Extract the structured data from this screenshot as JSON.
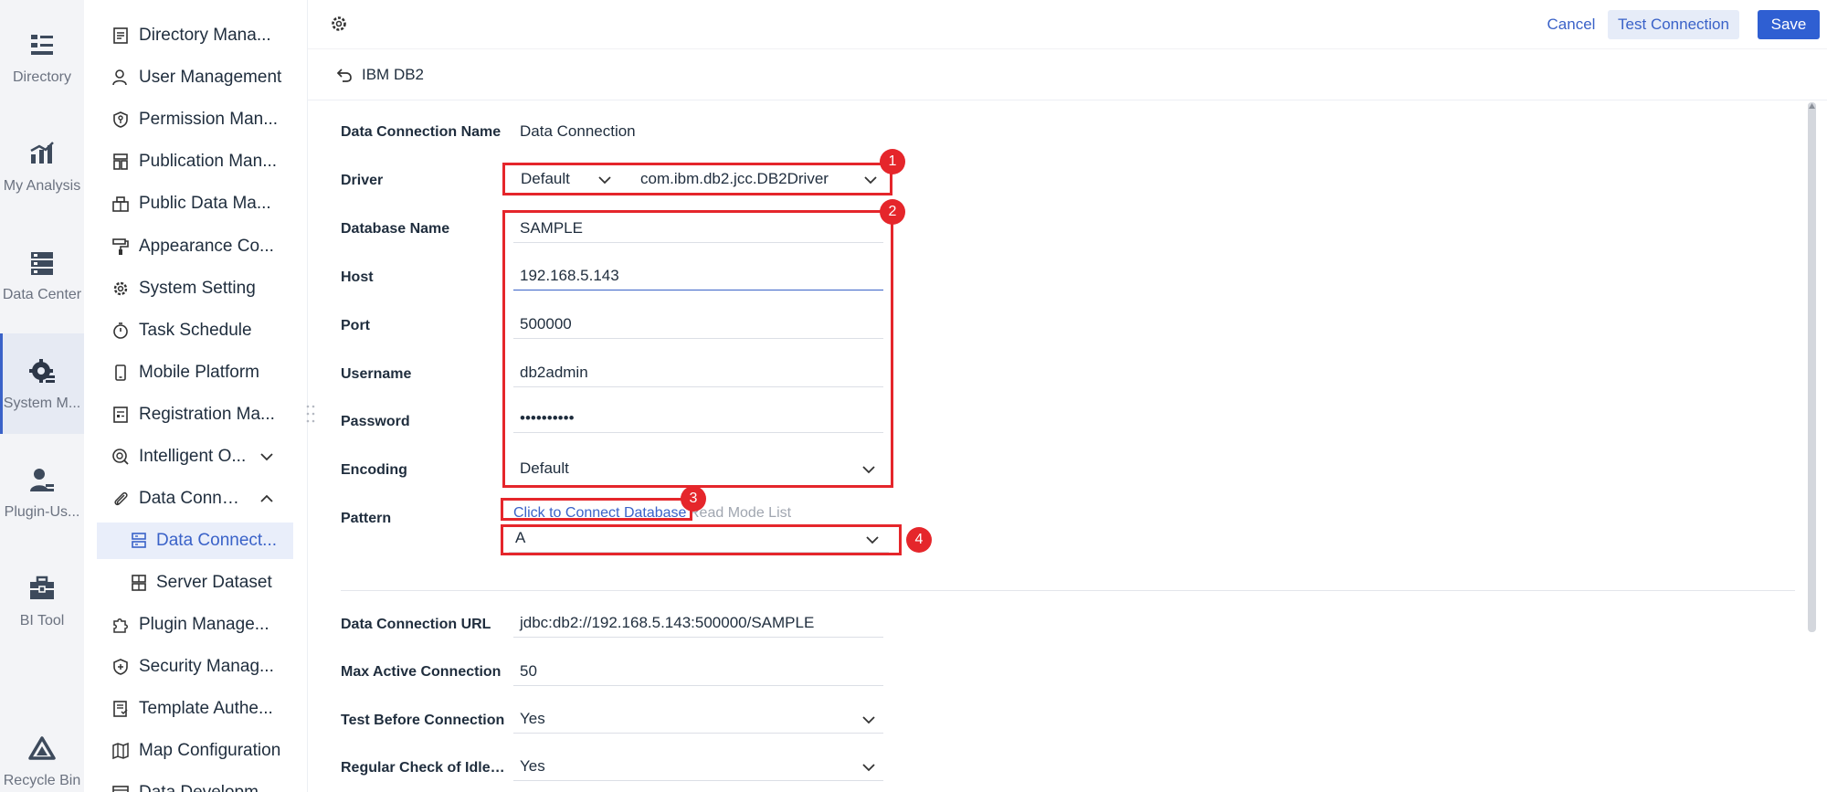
{
  "rail": {
    "items": [
      {
        "label": "Directory",
        "icon": "directory-icon"
      },
      {
        "label": "My Analysis",
        "icon": "analysis-icon"
      },
      {
        "label": "Data Center",
        "icon": "data-center-icon"
      },
      {
        "label": "System M...",
        "icon": "system-icon"
      },
      {
        "label": "Plugin-Us...",
        "icon": "plugin-user-icon"
      },
      {
        "label": "BI Tool",
        "icon": "toolbox-icon"
      },
      {
        "label": "Recycle Bin",
        "icon": "recycle-icon"
      }
    ]
  },
  "sidebar": {
    "items": [
      {
        "label": "Directory Mana...",
        "icon": "document-icon"
      },
      {
        "label": "User Management",
        "icon": "user-icon"
      },
      {
        "label": "Permission Man...",
        "icon": "shield-key-icon"
      },
      {
        "label": "Publication Man...",
        "icon": "publication-icon"
      },
      {
        "label": "Public Data Ma...",
        "icon": "cube-icon"
      },
      {
        "label": "Appearance Co...",
        "icon": "paint-roller-icon"
      },
      {
        "label": "System Setting",
        "icon": "gear-icon"
      },
      {
        "label": "Task Schedule",
        "icon": "stopwatch-icon"
      },
      {
        "label": "Mobile Platform",
        "icon": "mobile-icon"
      },
      {
        "label": "Registration Ma...",
        "icon": "registration-icon"
      },
      {
        "label": "Intelligent O...",
        "icon": "intelligent-icon"
      },
      {
        "label": "Data Connec...",
        "icon": "paperclip-icon"
      },
      {
        "label": "Data Connect...",
        "icon": "database-connection-icon"
      },
      {
        "label": "Server Dataset",
        "icon": "server-dataset-icon"
      },
      {
        "label": "Plugin Manage...",
        "icon": "puzzle-icon"
      },
      {
        "label": "Security Manag...",
        "icon": "security-shield-icon"
      },
      {
        "label": "Template Authe...",
        "icon": "template-icon"
      },
      {
        "label": "Map Configuration",
        "icon": "map-icon"
      },
      {
        "label": "Data Developm...",
        "icon": "data-development-icon"
      }
    ]
  },
  "topbar": {
    "cancel_label": "Cancel",
    "test_label": "Test Connection",
    "save_label": "Save"
  },
  "breadcrumb": {
    "title": "IBM DB2"
  },
  "form": {
    "connection_name_label": "Data Connection Name",
    "connection_name_value": "Data Connection",
    "driver_label": "Driver",
    "driver_type_value": "Default",
    "driver_class_value": "com.ibm.db2.jcc.DB2Driver",
    "database_name_label": "Database Name",
    "database_name_value": "SAMPLE",
    "host_label": "Host",
    "host_value": "192.168.5.143",
    "port_label": "Port",
    "port_value": "500000",
    "username_label": "Username",
    "username_value": "db2admin",
    "password_label": "Password",
    "password_value": "••••••••••",
    "encoding_label": "Encoding",
    "encoding_value": "Default",
    "pattern_label": "Pattern",
    "pattern_link": "Click to Connect Database",
    "pattern_hint": "Read Mode List",
    "pattern_value": "A",
    "url_label": "Data Connection URL",
    "url_value": "jdbc:db2://192.168.5.143:500000/SAMPLE",
    "max_active_label": "Max Active Connection",
    "max_active_value": "50",
    "test_before_label": "Test Before Connection",
    "test_before_value": "Yes",
    "regular_check_label": "Regular Check of Idle ...",
    "regular_check_value": "Yes"
  },
  "annotations": [
    "1",
    "2",
    "3",
    "4"
  ],
  "colors": {
    "accent": "#3a62c8",
    "save": "#2f5fd2",
    "annotation_red": "#e5262b"
  }
}
